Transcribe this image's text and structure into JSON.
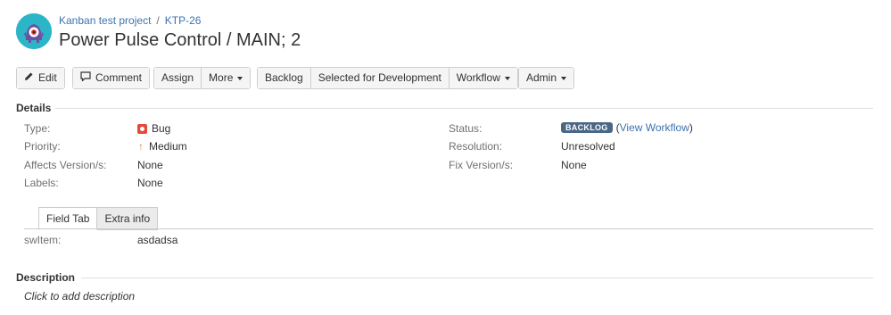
{
  "breadcrumb": {
    "project": "Kanban test project",
    "separator": "/",
    "issue_key": "KTP-26"
  },
  "issue": {
    "title": "Power Pulse Control / MAIN; 2"
  },
  "toolbar": {
    "edit": "Edit",
    "comment": "Comment",
    "assign": "Assign",
    "more": "More",
    "backlog": "Backlog",
    "selected_for_dev": "Selected for Development",
    "workflow": "Workflow",
    "admin": "Admin"
  },
  "details": {
    "heading": "Details",
    "type_label": "Type:",
    "type_value": "Bug",
    "priority_label": "Priority:",
    "priority_value": "Medium",
    "affects_label": "Affects Version/s:",
    "affects_value": "None",
    "labels_label": "Labels:",
    "labels_value": "None",
    "status_label": "Status:",
    "status_value": "BACKLOG",
    "status_paren_open": "(",
    "view_workflow": "View Workflow",
    "status_paren_close": ")",
    "resolution_label": "Resolution:",
    "resolution_value": "Unresolved",
    "fix_label": "Fix Version/s:",
    "fix_value": "None"
  },
  "tabs": [
    {
      "label": "Field Tab",
      "active": true
    },
    {
      "label": "Extra info",
      "active": false
    }
  ],
  "custom_field": {
    "label": "swItem:",
    "value": "asdadsa"
  },
  "description": {
    "heading": "Description",
    "placeholder": "Click to add description"
  },
  "colors": {
    "link": "#3b73af",
    "bug": "#e5493a",
    "priority_medium": "#e68a3a",
    "status_lozenge": "#4a6785",
    "avatar": "#2bb5c7"
  },
  "icons": {
    "avatar": "project-monster-avatar",
    "edit": "pencil-icon",
    "comment": "comment-bubble-icon",
    "type": "bug-icon",
    "priority": "arrow-up-icon"
  }
}
